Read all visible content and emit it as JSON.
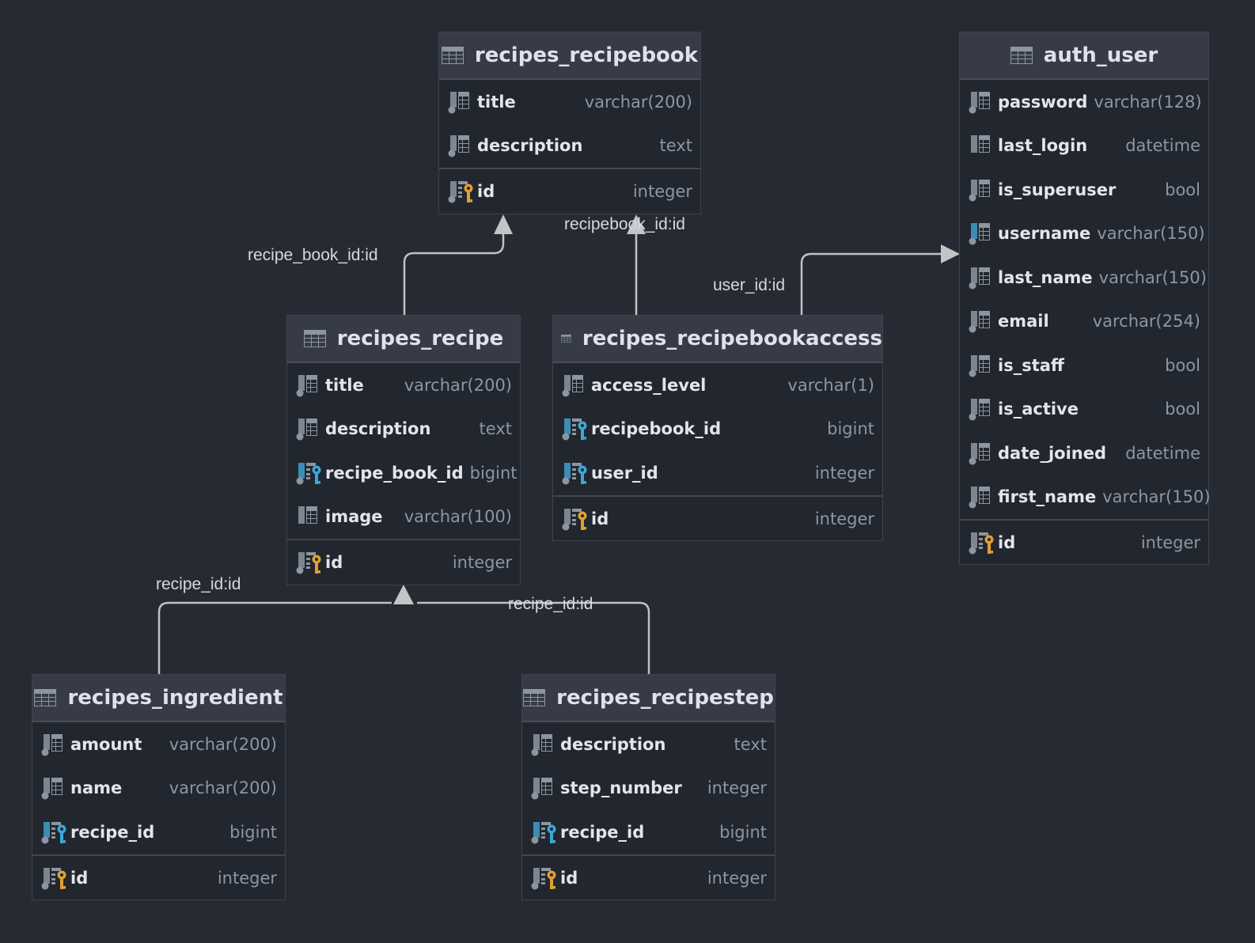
{
  "diagram": {
    "type": "database-er-diagram",
    "theme": "dark",
    "colors": {
      "background": "#262a33",
      "table_body": "#22262e",
      "table_header": "#363b47",
      "column_type": "#8c96a6",
      "pk_key": "#e0a030",
      "fk_key": "#3aa7d9",
      "connector": "#bfc1c4"
    }
  },
  "tables": {
    "recipebook": {
      "name": "recipes_recipebook",
      "columns": [
        {
          "name": "title",
          "type": "varchar(200)",
          "kind": "column-notnull"
        },
        {
          "name": "description",
          "type": "text",
          "kind": "column-notnull"
        }
      ],
      "pk": {
        "name": "id",
        "type": "integer",
        "kind": "primary-key"
      }
    },
    "auth_user": {
      "name": "auth_user",
      "columns": [
        {
          "name": "password",
          "type": "varchar(128)",
          "kind": "column-notnull"
        },
        {
          "name": "last_login",
          "type": "datetime",
          "kind": "column-nullable"
        },
        {
          "name": "is_superuser",
          "type": "bool",
          "kind": "column-notnull"
        },
        {
          "name": "username",
          "type": "varchar(150)",
          "kind": "column-unique"
        },
        {
          "name": "last_name",
          "type": "varchar(150)",
          "kind": "column-notnull"
        },
        {
          "name": "email",
          "type": "varchar(254)",
          "kind": "column-notnull"
        },
        {
          "name": "is_staff",
          "type": "bool",
          "kind": "column-notnull"
        },
        {
          "name": "is_active",
          "type": "bool",
          "kind": "column-notnull"
        },
        {
          "name": "date_joined",
          "type": "datetime",
          "kind": "column-notnull"
        },
        {
          "name": "first_name",
          "type": "varchar(150)",
          "kind": "column-notnull"
        }
      ],
      "pk": {
        "name": "id",
        "type": "integer",
        "kind": "primary-key"
      }
    },
    "recipe": {
      "name": "recipes_recipe",
      "columns": [
        {
          "name": "title",
          "type": "varchar(200)",
          "kind": "column-notnull"
        },
        {
          "name": "description",
          "type": "text",
          "kind": "column-notnull"
        },
        {
          "name": "recipe_book_id",
          "type": "bigint",
          "kind": "foreign-key"
        },
        {
          "name": "image",
          "type": "varchar(100)",
          "kind": "column-nullable"
        }
      ],
      "pk": {
        "name": "id",
        "type": "integer",
        "kind": "primary-key"
      }
    },
    "recipebookaccess": {
      "name": "recipes_recipebookaccess",
      "columns": [
        {
          "name": "access_level",
          "type": "varchar(1)",
          "kind": "column-notnull"
        },
        {
          "name": "recipebook_id",
          "type": "bigint",
          "kind": "foreign-key"
        },
        {
          "name": "user_id",
          "type": "integer",
          "kind": "foreign-key"
        }
      ],
      "pk": {
        "name": "id",
        "type": "integer",
        "kind": "primary-key"
      }
    },
    "ingredient": {
      "name": "recipes_ingredient",
      "columns": [
        {
          "name": "amount",
          "type": "varchar(200)",
          "kind": "column-notnull"
        },
        {
          "name": "name",
          "type": "varchar(200)",
          "kind": "column-notnull"
        },
        {
          "name": "recipe_id",
          "type": "bigint",
          "kind": "foreign-key"
        }
      ],
      "pk": {
        "name": "id",
        "type": "integer",
        "kind": "primary-key"
      }
    },
    "recipestep": {
      "name": "recipes_recipestep",
      "columns": [
        {
          "name": "description",
          "type": "text",
          "kind": "column-notnull"
        },
        {
          "name": "step_number",
          "type": "integer",
          "kind": "column-notnull"
        },
        {
          "name": "recipe_id",
          "type": "bigint",
          "kind": "foreign-key"
        }
      ],
      "pk": {
        "name": "id",
        "type": "integer",
        "kind": "primary-key"
      }
    }
  },
  "relations": [
    {
      "label": "recipe_book_id:id",
      "from": "recipes_recipe",
      "to": "recipes_recipebook"
    },
    {
      "label": "recipebook_id:id",
      "from": "recipes_recipebookaccess",
      "to": "recipes_recipebook"
    },
    {
      "label": "user_id:id",
      "from": "recipes_recipebookaccess",
      "to": "auth_user"
    },
    {
      "label": "recipe_id:id",
      "from": "recipes_ingredient",
      "to": "recipes_recipe"
    },
    {
      "label": "recipe_id:id",
      "from": "recipes_recipestep",
      "to": "recipes_recipe"
    }
  ]
}
